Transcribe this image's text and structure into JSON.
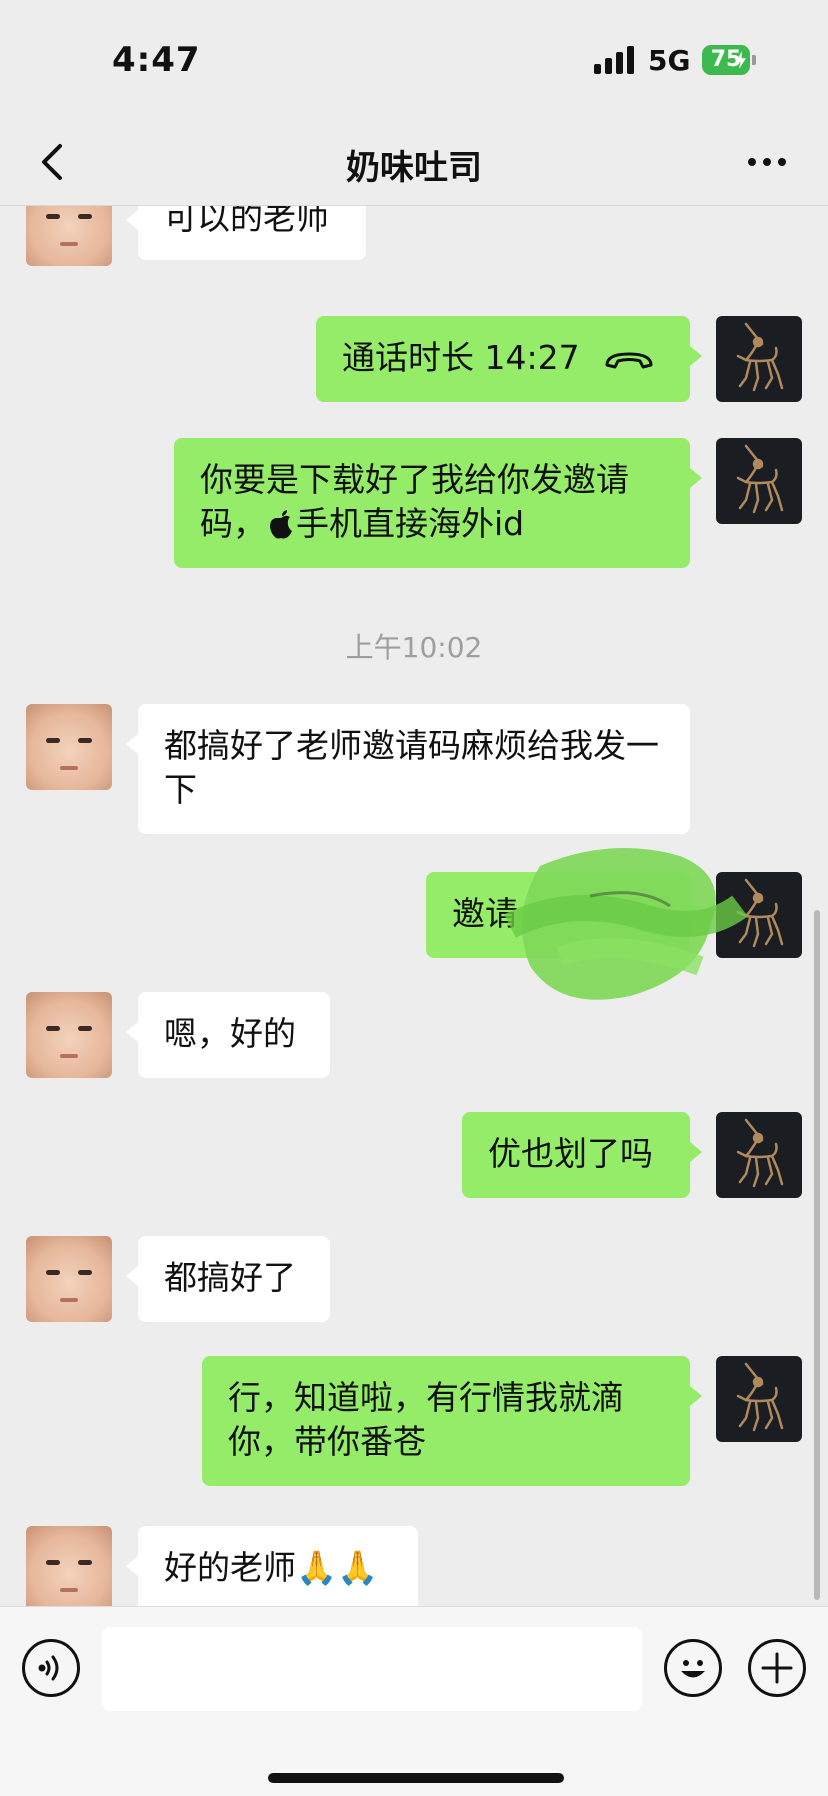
{
  "status_bar": {
    "time": "4:47",
    "network": "5G",
    "battery": "75"
  },
  "header": {
    "title": "奶味吐司"
  },
  "messages": [
    {
      "side": "left",
      "text": "可以的老师"
    },
    {
      "side": "right",
      "type": "call",
      "text": "通话时长 14:27"
    },
    {
      "side": "right",
      "text_before": "你要是下载好了我给你发邀请码，",
      "text_after": "手机直接海外id"
    },
    {
      "side": "left",
      "text": "都搞好了老师邀请码麻烦给我发一下"
    },
    {
      "side": "right",
      "text": "邀请"
    },
    {
      "side": "left",
      "text": "嗯，好的"
    },
    {
      "side": "right",
      "text": "优也划了吗"
    },
    {
      "side": "left",
      "text": "都搞好了"
    },
    {
      "side": "right",
      "text": "行，知道啦，有行情我就滴你，带你番苍"
    },
    {
      "side": "left",
      "text": "好的老师🙏🙏"
    }
  ],
  "timestamp": "上午10:02",
  "input": {
    "placeholder": ""
  },
  "colors": {
    "sent_bubble": "#95EC69",
    "received_bubble": "#FFFFFF",
    "background": "#EDEDED",
    "battery": "#3DBA4E"
  },
  "icons": [
    "back-icon",
    "more-icon",
    "voice-icon",
    "emoji-icon",
    "plus-icon",
    "handset-icon",
    "apple-icon"
  ]
}
